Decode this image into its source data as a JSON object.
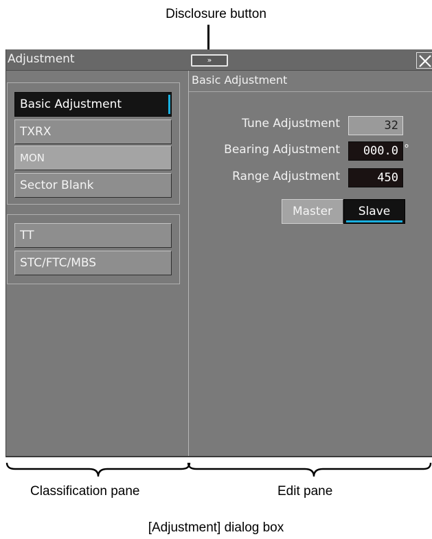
{
  "annotations": {
    "disclosure_callout": "Disclosure button",
    "classification_pane": "Classification pane",
    "edit_pane": "Edit pane",
    "caption": "[Adjustment] dialog box"
  },
  "dialog": {
    "title": "Adjustment",
    "disclosure_symbol": "»",
    "close_icon": "close-x-icon"
  },
  "classification": {
    "group1": [
      "Basic Adjustment",
      "TXRX",
      "MON",
      "Sector Blank"
    ],
    "group2": [
      "TT",
      "STC/FTC/MBS"
    ],
    "selected": "Basic Adjustment"
  },
  "edit": {
    "title": "Basic Adjustment",
    "tune_label": "Tune Adjustment",
    "tune_value": "32",
    "bearing_label": "Bearing Adjustment",
    "bearing_value": "000.0",
    "bearing_unit": "°",
    "range_label": "Range Adjustment",
    "range_value": "450",
    "master_label": "Master",
    "slave_label": "Slave",
    "selected_mode": "Slave"
  },
  "colors": {
    "dialog_bg": "#7a7a7a",
    "accent": "#19b0e0",
    "selected_bg": "#141414"
  }
}
